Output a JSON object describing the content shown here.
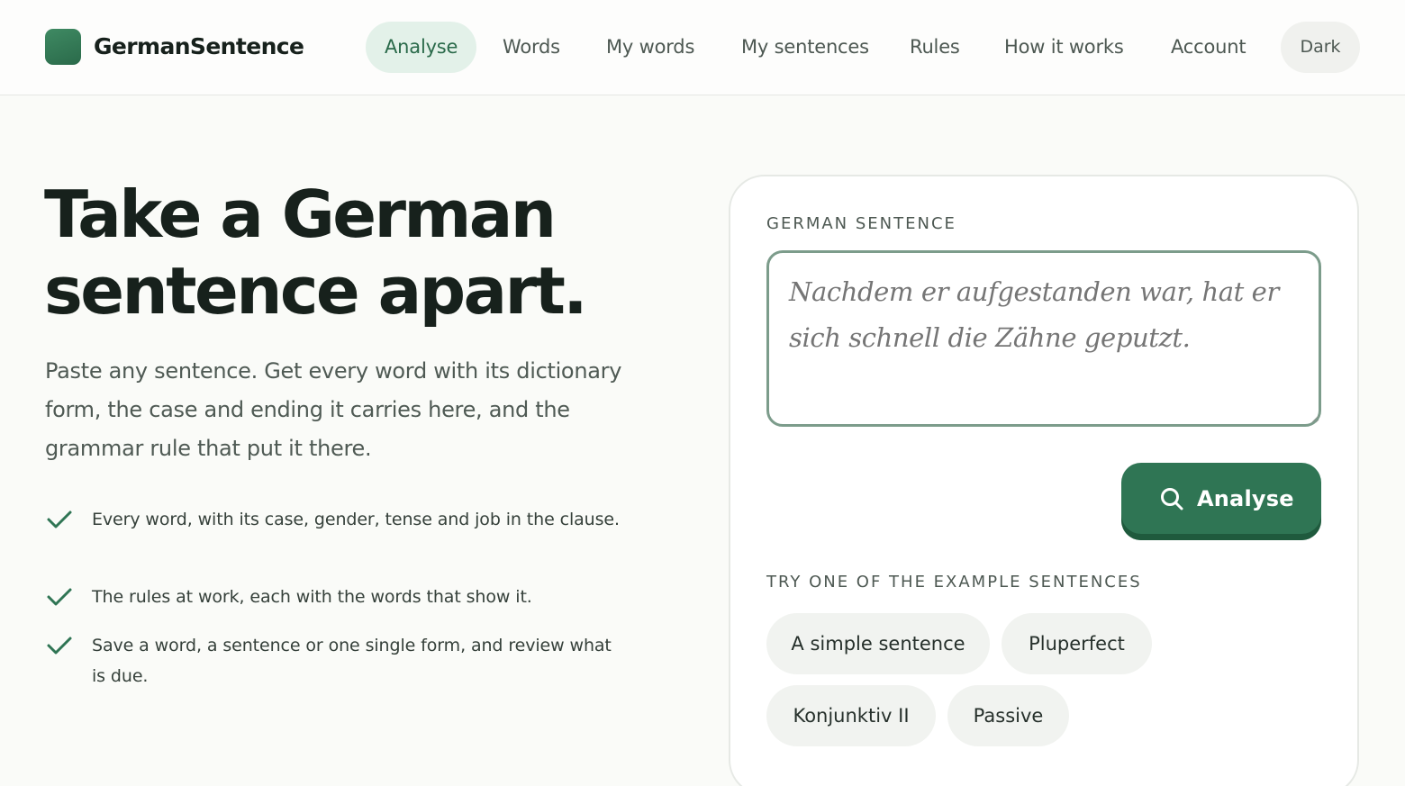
{
  "brand": {
    "name": "GermanSentence"
  },
  "nav": {
    "items": [
      {
        "label": "Analyse",
        "active": true
      },
      {
        "label": "Words"
      },
      {
        "label": "My words"
      },
      {
        "label": "My sentences"
      },
      {
        "label": "Rules"
      },
      {
        "label": "How it works"
      },
      {
        "label": "Account"
      }
    ],
    "theme_toggle": "Dark"
  },
  "hero": {
    "title_line1": "Take a German",
    "title_line2": "sentence apart.",
    "subtitle": "Paste any sentence. Get every word with its dictionary form, the case and ending it carries here, and the grammar rule that put it there.",
    "features": [
      "Every word, with its case, gender, tense and job in the clause.",
      "The rules at work, each with the words that show it.",
      "Save a word, a sentence or one single form, and review what is due."
    ]
  },
  "analyser": {
    "input_label": "German sentence",
    "placeholder": "Nachdem er aufgestanden war, hat er sich schnell die Zähne geputzt.",
    "value": "",
    "button_label": "Analyse",
    "examples_label": "Try one of the example sentences",
    "examples": [
      "A simple sentence",
      "Pluperfect",
      "Konjunktiv II",
      "Passive"
    ]
  },
  "colors": {
    "accent": "#2f7554",
    "accent_soft": "#e3f1e9",
    "background": "#fafbf8",
    "text": "#17211c"
  },
  "icons": {
    "logo": "logo-square-icon",
    "check": "check-icon",
    "search": "search-icon"
  }
}
